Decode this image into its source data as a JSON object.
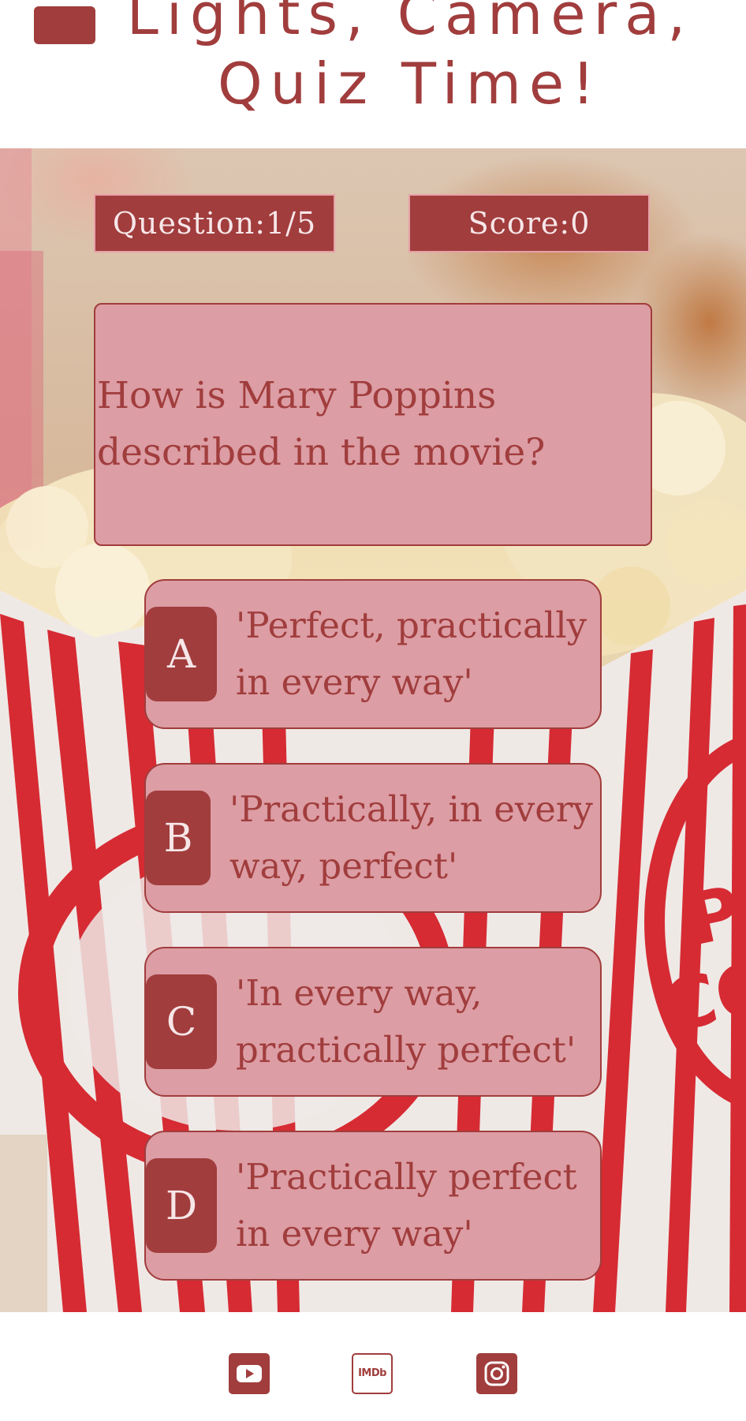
{
  "header": {
    "title": "Lights, Camera,\nQuiz Time!"
  },
  "stats": {
    "question_label": "Question:1/5",
    "score_label": "Score:0"
  },
  "question": {
    "text": "How is Mary Poppins described in the movie?"
  },
  "answers": [
    {
      "letter": "A",
      "text": "'Perfect, practically in every way'"
    },
    {
      "letter": "B",
      "text": "'Practically, in every way, perfect'"
    },
    {
      "letter": "C",
      "text": "'In every way, practically perfect'"
    },
    {
      "letter": "D",
      "text": "'Practically perfect in every way'"
    }
  ],
  "footer": {
    "icons": [
      "youtube-icon",
      "imdb-icon",
      "instagram-icon"
    ],
    "imdb_text": "IMDb"
  },
  "colors": {
    "accent": "#a13d3d",
    "card": "#dc9da4",
    "light_text": "#f7e6e8"
  }
}
